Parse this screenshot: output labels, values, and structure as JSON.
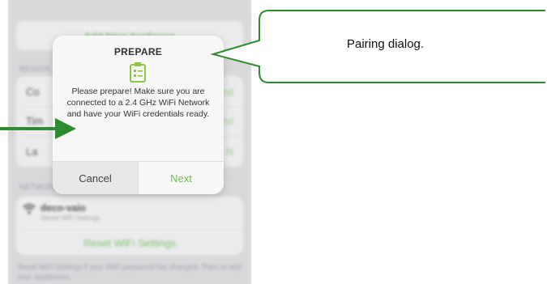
{
  "background": {
    "add_appliance": "Add New Appliance",
    "region_header": "REGION",
    "rows": [
      {
        "label": "Co",
        "value": "nd"
      },
      {
        "label": "Tim",
        "value": "nd"
      },
      {
        "label": "La",
        "value": "N"
      }
    ],
    "network_header": "NETWORK",
    "wifi_name": "deco-vaio",
    "wifi_sub": "Stored WiFi Settings",
    "reset_label": "Reset WiFi Settings",
    "note": "Reset WiFi Settings if your WiFi password has changed. Then re-add your appliances."
  },
  "dialog": {
    "title": "PREPARE",
    "icon": "clipboard-checklist-icon",
    "message": "Please prepare! Make sure you are connected to a 2.4 GHz WiFi Network and have your WiFi credentials ready.",
    "cancel_label": "Cancel",
    "next_label": "Next"
  },
  "annotation": {
    "callout_text": "Pairing dialog.",
    "color": "#2e8b2e"
  },
  "colors": {
    "accent_green": "#6abf4b",
    "icon_green": "#8cc63f"
  }
}
